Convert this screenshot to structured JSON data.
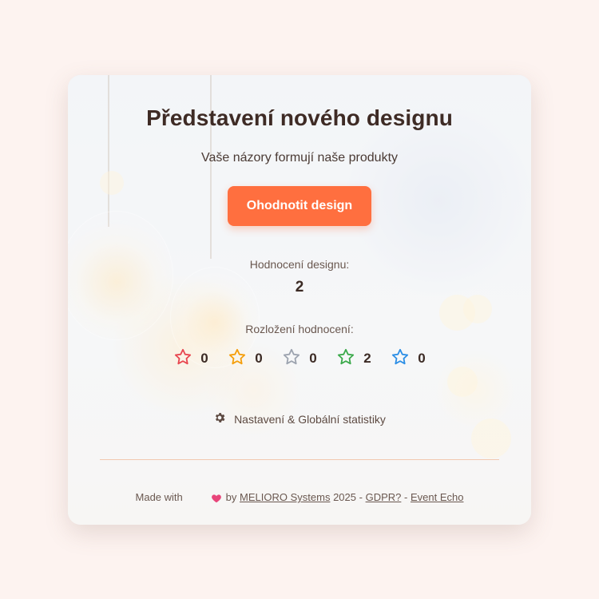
{
  "header": {
    "title": "Představení nového designu",
    "subtitle": "Vaše názory formují naše produkty"
  },
  "actions": {
    "rate_button_label": "Ohodnotit design"
  },
  "rating": {
    "label": "Hodnocení designu:",
    "value": "2"
  },
  "distribution": {
    "label": "Rozložení hodnocení:",
    "items": [
      {
        "icon": "star-outline-icon",
        "color": "#e8454f",
        "count": "0"
      },
      {
        "icon": "star-outline-icon",
        "color": "#f59e0b",
        "count": "0"
      },
      {
        "icon": "star-outline-icon",
        "color": "#9ca3af",
        "count": "0"
      },
      {
        "icon": "star-outline-icon",
        "color": "#3aa94a",
        "count": "2"
      },
      {
        "icon": "star-outline-icon",
        "color": "#2b8ee6",
        "count": "0"
      }
    ]
  },
  "settings": {
    "icon": "gear-icon",
    "label": "Nastavení & Globální statistiky"
  },
  "footer": {
    "made_with": "Made with",
    "heart_icon": "heart-icon",
    "by": "by",
    "company": "MELIORO Systems",
    "year_sep": "2025 -",
    "gdpr": "GDPR?",
    "sep": "-",
    "event": "Event Echo"
  },
  "colors": {
    "page_background": "#fdf3f0",
    "accent": "#ff6f3f",
    "text": "#3b2a24",
    "divider": "#f2c9b0"
  }
}
